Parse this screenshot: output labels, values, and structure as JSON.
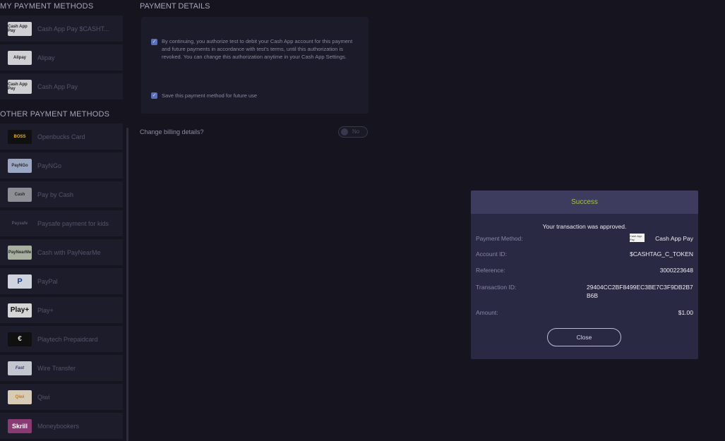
{
  "my_methods": {
    "title": "MY PAYMENT METHODS",
    "items": [
      {
        "logo": "Cash App Pay",
        "label": "Cash App Pay   $CASHT..."
      },
      {
        "logo": "Alipay",
        "label": "Alipay"
      },
      {
        "logo": "Cash App Pay",
        "label": "Cash App Pay"
      }
    ]
  },
  "other_methods": {
    "title": "OTHER PAYMENT METHODS",
    "items": [
      {
        "logo": "BOSS",
        "label": "Openbucks Card"
      },
      {
        "logo": "PayNGo",
        "label": "PayNGo"
      },
      {
        "logo": "Cash",
        "label": "Pay by Cash"
      },
      {
        "logo": "Paysafe",
        "label": "Paysafe payment for kids"
      },
      {
        "logo": "PayNearMe",
        "label": "Cash with PayNearMe"
      },
      {
        "logo": "P",
        "label": "PayPal"
      },
      {
        "logo": "Play+",
        "label": "Play+"
      },
      {
        "logo": "€",
        "label": "Playtech Prepaidcard"
      },
      {
        "logo": "Fast",
        "label": "Wire Transfer"
      },
      {
        "logo": "Qiwi",
        "label": "Qiwi"
      },
      {
        "logo": "Skrill",
        "label": "Moneybookers"
      }
    ]
  },
  "payment_details": {
    "title": "PAYMENT DETAILS",
    "authorize_text": "By continuing, you authorize test to debit your Cash App account for this payment and future payments in accordance with test's terms, until this authorization is revoked. You can change this authorization anytime in your Cash App Settings.",
    "save_text": "Save this payment method for future use",
    "billing_label": "Change billing details?",
    "toggle_text": "No"
  },
  "modal": {
    "title": "Success",
    "message": "Your transaction was approved.",
    "rows": {
      "payment_method_label": "Payment Method:",
      "payment_method_value": "Cash App Pay",
      "payment_method_logo": "Cash App Pay",
      "account_label": "Account ID:",
      "account_value": "$CASHTAG_C_TOKEN",
      "reference_label": "Reference:",
      "reference_value": "3000223648",
      "transaction_label": "Transaction ID:",
      "transaction_value": "29404CC2BF8499EC3BE7C3F9DB2B7B6B",
      "amount_label": "Amount:",
      "amount_value": "$1.00"
    },
    "close_label": "Close"
  },
  "colors": {
    "background": "#15141f",
    "success": "#a3c24a",
    "checkbox": "#5a6fb6"
  }
}
